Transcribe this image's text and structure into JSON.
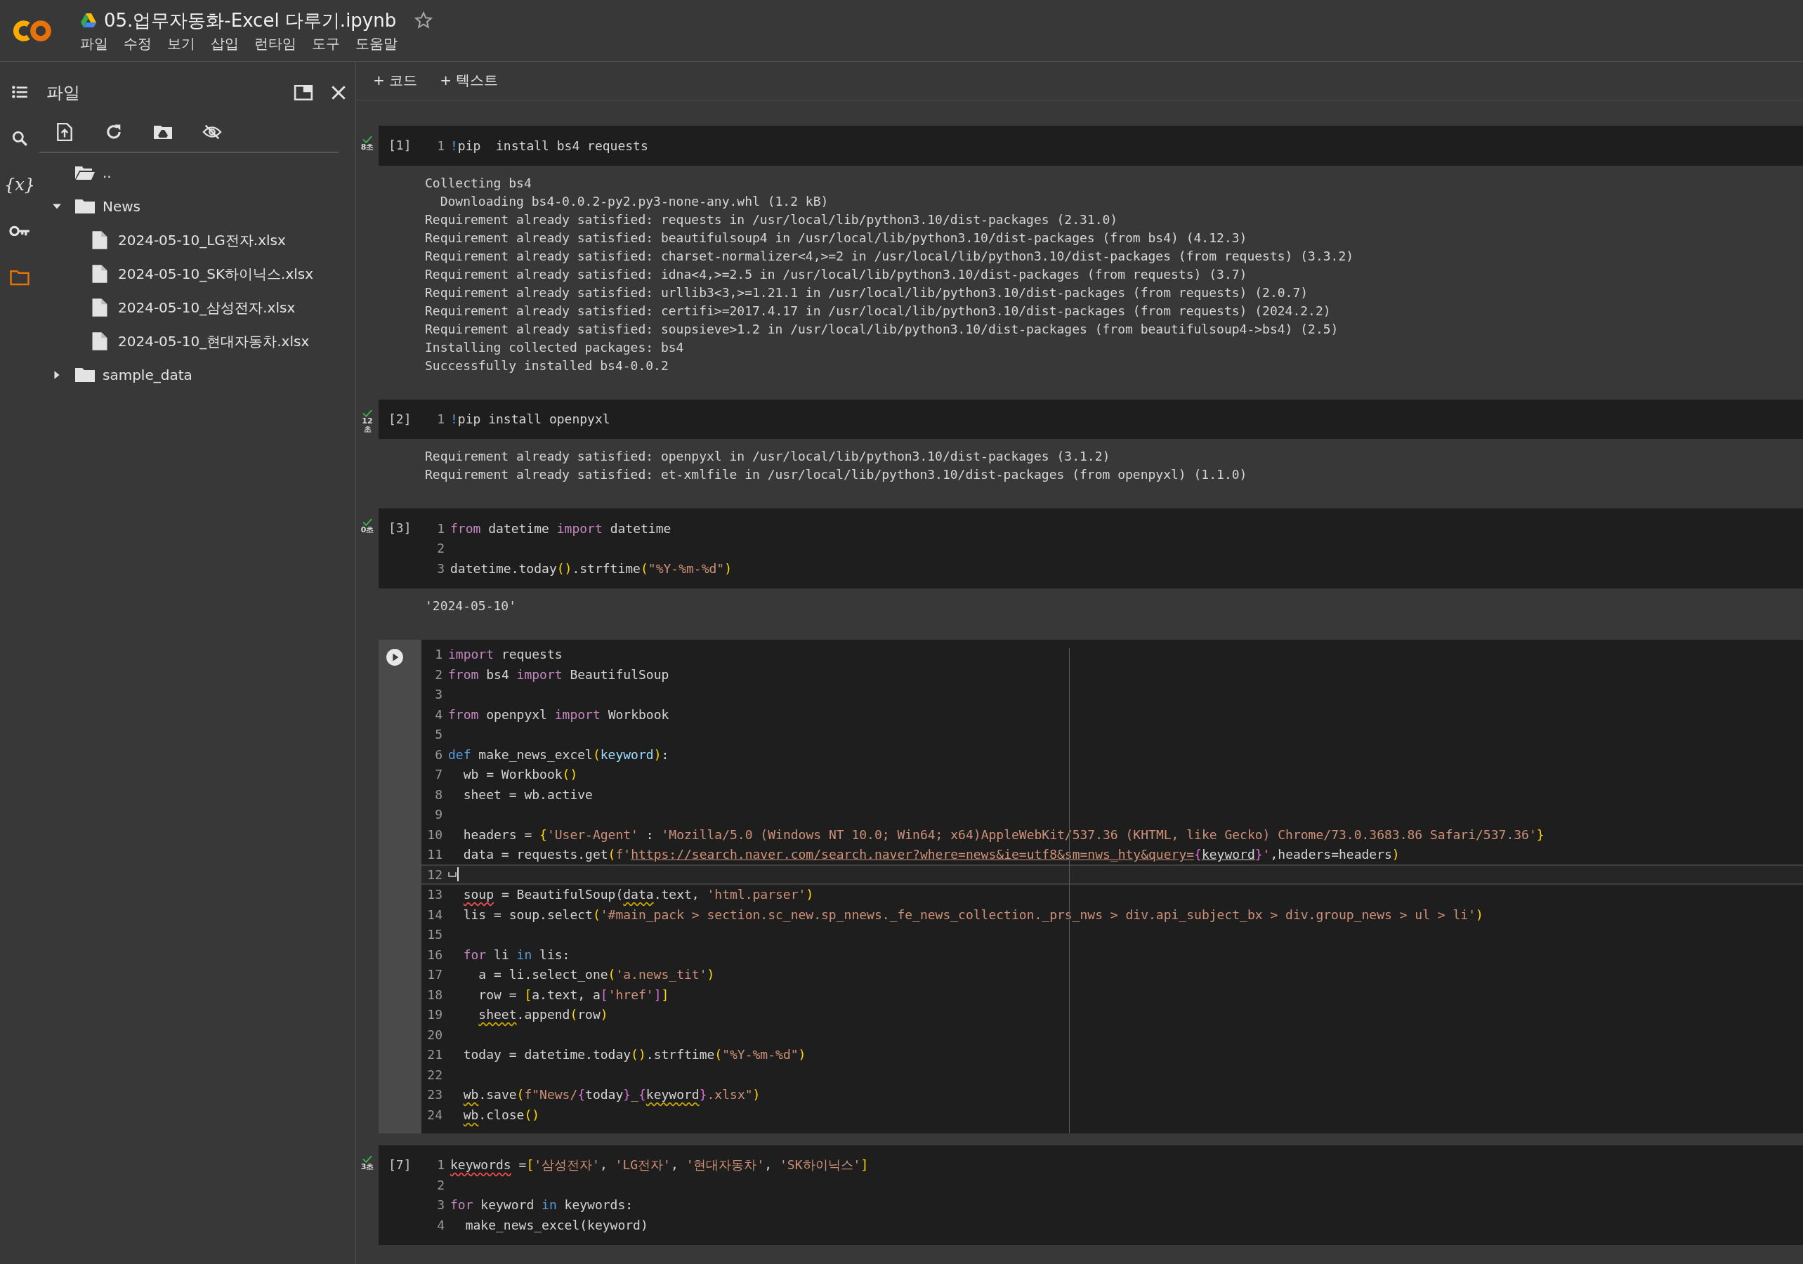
{
  "header": {
    "title": "05.업무자동화-Excel 다루기.ipynb",
    "starred": false,
    "menu": [
      "파일",
      "수정",
      "보기",
      "삽입",
      "런타임",
      "도구",
      "도움말"
    ]
  },
  "rail": [
    {
      "kind": "toc",
      "selected": false
    },
    {
      "kind": "search",
      "selected": false
    },
    {
      "kind": "variables",
      "label": "{x}",
      "selected": false
    },
    {
      "kind": "secrets",
      "selected": false
    },
    {
      "kind": "files",
      "selected": true
    }
  ],
  "sidebar": {
    "title": "파일",
    "tree": [
      {
        "label": "..",
        "kind": "parent"
      },
      {
        "label": "News",
        "kind": "folder",
        "expanded": true,
        "children": [
          {
            "label": "2024-05-10_LG전자.xlsx",
            "kind": "file"
          },
          {
            "label": "2024-05-10_SK하이닉스.xlsx",
            "kind": "file"
          },
          {
            "label": "2024-05-10_삼성전자.xlsx",
            "kind": "file"
          },
          {
            "label": "2024-05-10_현대자동차.xlsx",
            "kind": "file"
          }
        ]
      },
      {
        "label": "sample_data",
        "kind": "folder",
        "expanded": false
      }
    ]
  },
  "toolbar": [
    {
      "label": "+ 코드"
    },
    {
      "label": "+ 텍스트"
    }
  ],
  "cells": [
    {
      "count": "[1]",
      "done": true,
      "time": "8초",
      "focused": false,
      "lines": [
        {
          "number": "1",
          "tokens": [
            {
              "text": "!",
              "kind": "kw2"
            },
            {
              "text": "pip  install bs4 requests",
              "kind": "plain"
            }
          ]
        }
      ],
      "output": [
        "Collecting bs4",
        "  Downloading bs4-0.0.2-py2.py3-none-any.whl (1.2 kB)",
        "Requirement already satisfied: requests in /usr/local/lib/python3.10/dist-packages (2.31.0)",
        "Requirement already satisfied: beautifulsoup4 in /usr/local/lib/python3.10/dist-packages (from bs4) (4.12.3)",
        "Requirement already satisfied: charset-normalizer<4,>=2 in /usr/local/lib/python3.10/dist-packages (from requests) (3.3.2)",
        "Requirement already satisfied: idna<4,>=2.5 in /usr/local/lib/python3.10/dist-packages (from requests) (3.7)",
        "Requirement already satisfied: urllib3<3,>=1.21.1 in /usr/local/lib/python3.10/dist-packages (from requests) (2.0.7)",
        "Requirement already satisfied: certifi>=2017.4.17 in /usr/local/lib/python3.10/dist-packages (from requests) (2024.2.2)",
        "Requirement already satisfied: soupsieve>1.2 in /usr/local/lib/python3.10/dist-packages (from beautifulsoup4->bs4) (2.5)",
        "Installing collected packages: bs4",
        "Successfully installed bs4-0.0.2"
      ]
    },
    {
      "count": "[2]",
      "done": true,
      "time": "12초",
      "focused": false,
      "lines": [
        {
          "number": "1",
          "tokens": [
            {
              "text": "!",
              "kind": "kw2"
            },
            {
              "text": "pip install openpyxl",
              "kind": "plain"
            }
          ]
        }
      ],
      "output": [
        "Requirement already satisfied: openpyxl in /usr/local/lib/python3.10/dist-packages (3.1.2)",
        "Requirement already satisfied: et-xmlfile in /usr/local/lib/python3.10/dist-packages (from openpyxl) (1.1.0)"
      ]
    },
    {
      "count": "[3]",
      "done": true,
      "time": "0초",
      "focused": false,
      "lines": [
        {
          "number": "1",
          "tokens": [
            {
              "text": "from",
              "kind": "kw"
            },
            {
              "text": " datetime ",
              "kind": "plain"
            },
            {
              "text": "import",
              "kind": "kw"
            },
            {
              "text": " datetime",
              "kind": "plain"
            }
          ]
        },
        {
          "number": "2"
        },
        {
          "number": "3",
          "tokens": [
            {
              "text": "datetime.today",
              "kind": "plain"
            },
            {
              "text": "()",
              "kind": "br"
            },
            {
              "text": ".strftime",
              "kind": "plain"
            },
            {
              "text": "(",
              "kind": "br"
            },
            {
              "text": "\"%Y-%m-%d\"",
              "kind": "str"
            },
            {
              "text": ")",
              "kind": "br"
            }
          ]
        }
      ],
      "output": [
        "'2024-05-10'"
      ]
    },
    {
      "done": false,
      "focused": true,
      "lines": [
        {
          "number": "1",
          "current": false,
          "tokens": [
            {
              "text": "import",
              "kind": "kw"
            },
            {
              "text": " requests",
              "kind": "plain"
            }
          ]
        },
        {
          "number": "2",
          "current": false,
          "tokens": [
            {
              "text": "from",
              "kind": "kw"
            },
            {
              "text": " bs4 ",
              "kind": "plain"
            },
            {
              "text": "import",
              "kind": "kw"
            },
            {
              "text": " BeautifulSoup",
              "kind": "plain"
            }
          ]
        },
        {
          "number": "3",
          "current": false
        },
        {
          "number": "4",
          "current": false,
          "tokens": [
            {
              "text": "from",
              "kind": "kw"
            },
            {
              "text": " openpyxl ",
              "kind": "plain"
            },
            {
              "text": "import",
              "kind": "kw"
            },
            {
              "text": " Workbook",
              "kind": "plain"
            }
          ]
        },
        {
          "number": "5",
          "current": false
        },
        {
          "number": "6",
          "current": false,
          "tokens": [
            {
              "text": "def",
              "kind": "kw2"
            },
            {
              "text": " make_news_excel",
              "kind": "plain"
            },
            {
              "text": "(",
              "kind": "br"
            },
            {
              "text": "keyword",
              "kind": "param"
            },
            {
              "text": ")",
              "kind": "br"
            },
            {
              "text": ":",
              "kind": "plain"
            }
          ]
        },
        {
          "number": "7",
          "current": false,
          "tokens": [
            {
              "text": "  wb = Workbook",
              "kind": "plain"
            },
            {
              "text": "()",
              "kind": "br"
            }
          ]
        },
        {
          "number": "8",
          "current": false,
          "tokens": [
            {
              "text": "  sheet = wb.active",
              "kind": "plain"
            }
          ]
        },
        {
          "number": "9",
          "current": false
        },
        {
          "number": "10",
          "current": false,
          "tokens": [
            {
              "text": "  headers = ",
              "kind": "plain"
            },
            {
              "text": "{",
              "kind": "br"
            },
            {
              "text": "'User-Agent'",
              "kind": "str"
            },
            {
              "text": " : ",
              "kind": "plain"
            },
            {
              "text": "'Mozilla/5.0 (Windows NT 10.0; Win64; x64)AppleWebKit/537.36 (KHTML, like Gecko) Chrome/73.0.3683.86 Safari/537.36'",
              "kind": "str"
            },
            {
              "text": "}",
              "kind": "br"
            }
          ]
        },
        {
          "number": "11",
          "current": false,
          "tokens": [
            {
              "text": "  data = requests.get",
              "kind": "plain"
            },
            {
              "text": "(",
              "kind": "br"
            },
            {
              "text": "f'",
              "kind": "str"
            },
            {
              "text": "https://search.naver.com/search.naver?where=news&ie=utf8&sm=nws_hty&query=",
              "kind": "link"
            },
            {
              "text": "{",
              "kind": "br2"
            },
            {
              "text": "keyword",
              "kind": "linkvar"
            },
            {
              "text": "}",
              "kind": "br2"
            },
            {
              "text": "'",
              "kind": "str"
            },
            {
              "text": ",headers=headers",
              "kind": "plain"
            },
            {
              "text": ")",
              "kind": "br"
            }
          ]
        },
        {
          "number": "12",
          "current": true
        },
        {
          "number": "13",
          "current": false,
          "tokens": [
            {
              "text": "  soup",
              "kind": "err"
            },
            {
              "text": " = BeautifulSoup(",
              "kind": "plain"
            },
            {
              "text": "data",
              "kind": "warn"
            },
            {
              "text": ".text, ",
              "kind": "plain"
            },
            {
              "text": "'html.parser'",
              "kind": "str"
            },
            {
              "text": ")",
              "kind": "br"
            }
          ]
        },
        {
          "number": "14",
          "current": false,
          "tokens": [
            {
              "text": "  lis = soup.select",
              "kind": "plain"
            },
            {
              "text": "(",
              "kind": "br"
            },
            {
              "text": "'#main_pack > section.sc_new.sp_nnews._fe_news_collection._prs_nws > div.api_subject_bx > div.group_news > ul > li'",
              "kind": "str"
            },
            {
              "text": ")",
              "kind": "br"
            }
          ]
        },
        {
          "number": "15",
          "current": false
        },
        {
          "number": "16",
          "current": false,
          "tokens": [
            {
              "text": "  for",
              "kind": "kw"
            },
            {
              "text": " li ",
              "kind": "plain"
            },
            {
              "text": "in",
              "kind": "kw2"
            },
            {
              "text": " lis:",
              "kind": "plain"
            }
          ]
        },
        {
          "number": "17",
          "current": false,
          "tokens": [
            {
              "text": "    a = li.select_one",
              "kind": "plain"
            },
            {
              "text": "(",
              "kind": "br"
            },
            {
              "text": "'a.news_tit'",
              "kind": "str"
            },
            {
              "text": ")",
              "kind": "br"
            }
          ]
        },
        {
          "number": "18",
          "current": false,
          "tokens": [
            {
              "text": "    row = ",
              "kind": "plain"
            },
            {
              "text": "[",
              "kind": "br"
            },
            {
              "text": "a.text, a",
              "kind": "plain"
            },
            {
              "text": "[",
              "kind": "br2"
            },
            {
              "text": "'href'",
              "kind": "str"
            },
            {
              "text": "]",
              "kind": "br2"
            },
            {
              "text": "]",
              "kind": "br"
            }
          ]
        },
        {
          "number": "19",
          "current": false,
          "tokens": [
            {
              "text": "    sheet",
              "kind": "warn"
            },
            {
              "text": ".append",
              "kind": "plain"
            },
            {
              "text": "(",
              "kind": "br"
            },
            {
              "text": "row",
              "kind": "plain"
            },
            {
              "text": ")",
              "kind": "br"
            }
          ]
        },
        {
          "number": "20",
          "current": false
        },
        {
          "number": "21",
          "current": false,
          "tokens": [
            {
              "text": "  today = datetime.today",
              "kind": "plain"
            },
            {
              "text": "()",
              "kind": "br"
            },
            {
              "text": ".strftime",
              "kind": "plain"
            },
            {
              "text": "(",
              "kind": "br"
            },
            {
              "text": "\"%Y-%m-%d\"",
              "kind": "str"
            },
            {
              "text": ")",
              "kind": "br"
            }
          ]
        },
        {
          "number": "22",
          "current": false
        },
        {
          "number": "23",
          "current": false,
          "tokens": [
            {
              "text": "  wb",
              "kind": "warn"
            },
            {
              "text": ".save",
              "kind": "plain"
            },
            {
              "text": "(",
              "kind": "br"
            },
            {
              "text": "f\"News/",
              "kind": "str"
            },
            {
              "text": "{",
              "kind": "br2"
            },
            {
              "text": "today",
              "kind": "plain"
            },
            {
              "text": "}",
              "kind": "br2"
            },
            {
              "text": "_",
              "kind": "str"
            },
            {
              "text": "{",
              "kind": "br2"
            },
            {
              "text": "keyword",
              "kind": "warn"
            },
            {
              "text": "}",
              "kind": "br2"
            },
            {
              "text": ".xlsx\"",
              "kind": "str"
            },
            {
              "text": ")",
              "kind": "br"
            }
          ]
        },
        {
          "number": "24",
          "current": false,
          "tokens": [
            {
              "text": "  wb",
              "kind": "warn"
            },
            {
              "text": ".close",
              "kind": "plain"
            },
            {
              "text": "()",
              "kind": "br"
            }
          ]
        }
      ]
    },
    {
      "count": "[7]",
      "done": true,
      "time": "3초",
      "focused": false,
      "lines": [
        {
          "number": "1",
          "tokens": [
            {
              "text": "keywords",
              "kind": "err"
            },
            {
              "text": " =",
              "kind": "plain"
            },
            {
              "text": "[",
              "kind": "br"
            },
            {
              "text": "'삼성전자'",
              "kind": "str"
            },
            {
              "text": ", ",
              "kind": "plain"
            },
            {
              "text": "'LG전자'",
              "kind": "str"
            },
            {
              "text": ", ",
              "kind": "plain"
            },
            {
              "text": "'현대자동차'",
              "kind": "str"
            },
            {
              "text": ", ",
              "kind": "plain"
            },
            {
              "text": "'SK하이닉스'",
              "kind": "str"
            },
            {
              "text": "]",
              "kind": "br"
            }
          ]
        },
        {
          "number": "2"
        },
        {
          "number": "3",
          "tokens": [
            {
              "text": "for",
              "kind": "kw"
            },
            {
              "text": " keyword ",
              "kind": "plain"
            },
            {
              "text": "in",
              "kind": "kw2"
            },
            {
              "text": " keywords:",
              "kind": "plain"
            }
          ]
        },
        {
          "number": "4",
          "tokens": [
            {
              "text": "  make_news_excel(keyword)",
              "kind": "plain"
            }
          ]
        }
      ]
    }
  ]
}
